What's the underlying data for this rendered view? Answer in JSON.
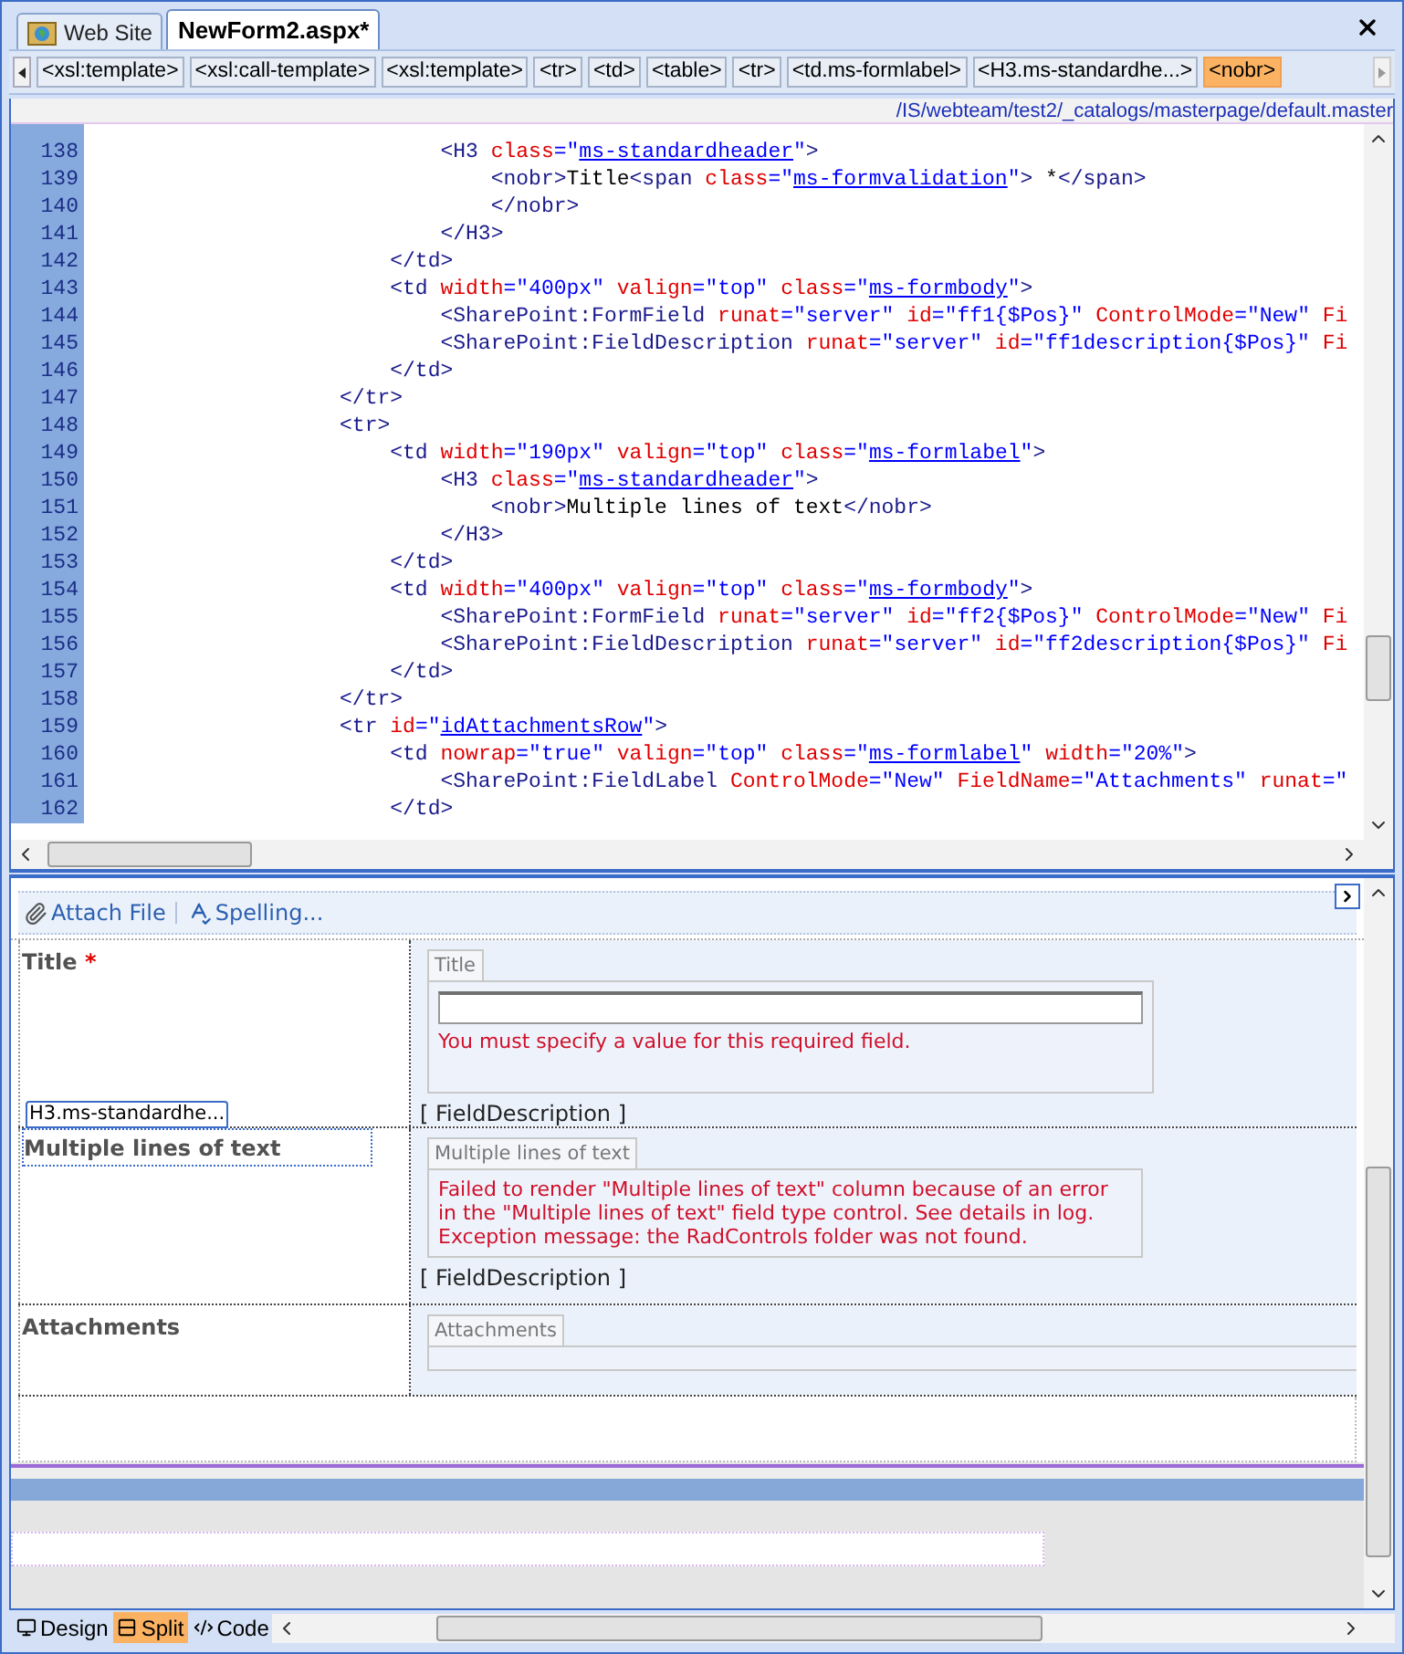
{
  "tabs": [
    {
      "label": "Web Site",
      "kind": "site",
      "selected": false
    },
    {
      "label": "NewForm2.aspx*",
      "kind": "file",
      "selected": true
    }
  ],
  "tag_path": [
    {
      "label": "<xsl:template>",
      "selected": false
    },
    {
      "label": "<xsl:call-template>",
      "selected": false
    },
    {
      "label": "<xsl:template>",
      "selected": false
    },
    {
      "label": "<tr>",
      "selected": false
    },
    {
      "label": "<td>",
      "selected": false
    },
    {
      "label": "<table>",
      "selected": false
    },
    {
      "label": "<tr>",
      "selected": false
    },
    {
      "label": "<td.ms-formlabel>",
      "selected": false
    },
    {
      "label": "<H3.ms-standardhe...>",
      "selected": false
    },
    {
      "label": "<nobr>",
      "selected": true
    }
  ],
  "file_path": "/IS/webteam/test2/_catalogs/masterpage/default.master",
  "code_lines": [
    {
      "number": "138",
      "tokens": [
        {
          "kind": "tag",
          "text": "                            <H3"
        },
        {
          "kind": "attr",
          "text": " class"
        },
        {
          "kind": "value",
          "text": "=\""
        },
        {
          "kind": "link",
          "text": "ms-standardheader"
        },
        {
          "kind": "value",
          "text": "\""
        },
        {
          "kind": "tag",
          "text": ">"
        }
      ]
    },
    {
      "number": "139",
      "tokens": [
        {
          "kind": "tag",
          "text": "                                <nobr>"
        },
        {
          "kind": "text",
          "text": "Title"
        },
        {
          "kind": "tag",
          "text": "<span"
        },
        {
          "kind": "attr",
          "text": " class"
        },
        {
          "kind": "value",
          "text": "=\""
        },
        {
          "kind": "link",
          "text": "ms-formvalidation"
        },
        {
          "kind": "value",
          "text": "\""
        },
        {
          "kind": "tag",
          "text": ">"
        },
        {
          "kind": "text",
          "text": " *"
        },
        {
          "kind": "tag",
          "text": "</span>"
        }
      ]
    },
    {
      "number": "140",
      "tokens": [
        {
          "kind": "tag",
          "text": "                                </nobr>"
        }
      ]
    },
    {
      "number": "141",
      "tokens": [
        {
          "kind": "tag",
          "text": "                            </H3>"
        }
      ]
    },
    {
      "number": "142",
      "tokens": [
        {
          "kind": "tag",
          "text": "                        </td>"
        }
      ]
    },
    {
      "number": "143",
      "tokens": [
        {
          "kind": "tag",
          "text": "                        <td"
        },
        {
          "kind": "attr",
          "text": " width"
        },
        {
          "kind": "value",
          "text": "=\"400px\""
        },
        {
          "kind": "attr",
          "text": " valign"
        },
        {
          "kind": "value",
          "text": "=\"top\""
        },
        {
          "kind": "attr",
          "text": " class"
        },
        {
          "kind": "value",
          "text": "=\""
        },
        {
          "kind": "link",
          "text": "ms-formbody"
        },
        {
          "kind": "value",
          "text": "\""
        },
        {
          "kind": "tag",
          "text": ">"
        }
      ]
    },
    {
      "number": "144",
      "tokens": [
        {
          "kind": "tag",
          "text": "                            <SharePoint:FormField"
        },
        {
          "kind": "attr",
          "text": " runat"
        },
        {
          "kind": "value",
          "text": "=\"server\""
        },
        {
          "kind": "attr",
          "text": " id"
        },
        {
          "kind": "value",
          "text": "=\"ff1{$Pos}\""
        },
        {
          "kind": "attr",
          "text": " ControlMode"
        },
        {
          "kind": "value",
          "text": "=\"New\""
        },
        {
          "kind": "attr",
          "text": " Fi"
        }
      ]
    },
    {
      "number": "145",
      "tokens": [
        {
          "kind": "tag",
          "text": "                            <SharePoint:FieldDescription"
        },
        {
          "kind": "attr",
          "text": " runat"
        },
        {
          "kind": "value",
          "text": "=\"server\""
        },
        {
          "kind": "attr",
          "text": " id"
        },
        {
          "kind": "value",
          "text": "=\"ff1description{$Pos}\""
        },
        {
          "kind": "attr",
          "text": " Fi"
        }
      ]
    },
    {
      "number": "146",
      "tokens": [
        {
          "kind": "tag",
          "text": "                        </td>"
        }
      ]
    },
    {
      "number": "147",
      "tokens": [
        {
          "kind": "tag",
          "text": "                    </tr>"
        }
      ]
    },
    {
      "number": "148",
      "tokens": [
        {
          "kind": "tag",
          "text": "                    <tr>"
        }
      ]
    },
    {
      "number": "149",
      "tokens": [
        {
          "kind": "tag",
          "text": "                        <td"
        },
        {
          "kind": "attr",
          "text": " width"
        },
        {
          "kind": "value",
          "text": "=\"190px\""
        },
        {
          "kind": "attr",
          "text": " valign"
        },
        {
          "kind": "value",
          "text": "=\"top\""
        },
        {
          "kind": "attr",
          "text": " class"
        },
        {
          "kind": "value",
          "text": "=\""
        },
        {
          "kind": "link",
          "text": "ms-formlabel"
        },
        {
          "kind": "value",
          "text": "\""
        },
        {
          "kind": "tag",
          "text": ">"
        }
      ]
    },
    {
      "number": "150",
      "tokens": [
        {
          "kind": "tag",
          "text": "                            <H3"
        },
        {
          "kind": "attr",
          "text": " class"
        },
        {
          "kind": "value",
          "text": "=\""
        },
        {
          "kind": "link",
          "text": "ms-standardheader"
        },
        {
          "kind": "value",
          "text": "\""
        },
        {
          "kind": "tag",
          "text": ">"
        }
      ]
    },
    {
      "number": "151",
      "tokens": [
        {
          "kind": "tag",
          "text": "                                <nobr>"
        },
        {
          "kind": "text",
          "text": "Multiple lines of text"
        },
        {
          "kind": "tag",
          "text": "</nobr>"
        }
      ]
    },
    {
      "number": "152",
      "tokens": [
        {
          "kind": "tag",
          "text": "                            </H3>"
        }
      ]
    },
    {
      "number": "153",
      "tokens": [
        {
          "kind": "tag",
          "text": "                        </td>"
        }
      ]
    },
    {
      "number": "154",
      "tokens": [
        {
          "kind": "tag",
          "text": "                        <td"
        },
        {
          "kind": "attr",
          "text": " width"
        },
        {
          "kind": "value",
          "text": "=\"400px\""
        },
        {
          "kind": "attr",
          "text": " valign"
        },
        {
          "kind": "value",
          "text": "=\"top\""
        },
        {
          "kind": "attr",
          "text": " class"
        },
        {
          "kind": "value",
          "text": "=\""
        },
        {
          "kind": "link",
          "text": "ms-formbody"
        },
        {
          "kind": "value",
          "text": "\""
        },
        {
          "kind": "tag",
          "text": ">"
        }
      ]
    },
    {
      "number": "155",
      "tokens": [
        {
          "kind": "tag",
          "text": "                            <SharePoint:FormField"
        },
        {
          "kind": "attr",
          "text": " runat"
        },
        {
          "kind": "value",
          "text": "=\"server\""
        },
        {
          "kind": "attr",
          "text": " id"
        },
        {
          "kind": "value",
          "text": "=\"ff2{$Pos}\""
        },
        {
          "kind": "attr",
          "text": " ControlMode"
        },
        {
          "kind": "value",
          "text": "=\"New\""
        },
        {
          "kind": "attr",
          "text": " Fi"
        }
      ]
    },
    {
      "number": "156",
      "tokens": [
        {
          "kind": "tag",
          "text": "                            <SharePoint:FieldDescription"
        },
        {
          "kind": "attr",
          "text": " runat"
        },
        {
          "kind": "value",
          "text": "=\"server\""
        },
        {
          "kind": "attr",
          "text": " id"
        },
        {
          "kind": "value",
          "text": "=\"ff2description{$Pos}\""
        },
        {
          "kind": "attr",
          "text": " Fi"
        }
      ]
    },
    {
      "number": "157",
      "tokens": [
        {
          "kind": "tag",
          "text": "                        </td>"
        }
      ]
    },
    {
      "number": "158",
      "tokens": [
        {
          "kind": "tag",
          "text": "                    </tr>"
        }
      ]
    },
    {
      "number": "159",
      "tokens": [
        {
          "kind": "tag",
          "text": "                    <tr"
        },
        {
          "kind": "attr",
          "text": " id"
        },
        {
          "kind": "value",
          "text": "=\""
        },
        {
          "kind": "link",
          "text": "idAttachmentsRow"
        },
        {
          "kind": "value",
          "text": "\""
        },
        {
          "kind": "tag",
          "text": ">"
        }
      ]
    },
    {
      "number": "160",
      "tokens": [
        {
          "kind": "tag",
          "text": "                        <td"
        },
        {
          "kind": "attr",
          "text": " nowrap"
        },
        {
          "kind": "value",
          "text": "=\"true\""
        },
        {
          "kind": "attr",
          "text": " valign"
        },
        {
          "kind": "value",
          "text": "=\"top\""
        },
        {
          "kind": "attr",
          "text": " class"
        },
        {
          "kind": "value",
          "text": "=\""
        },
        {
          "kind": "link",
          "text": "ms-formlabel"
        },
        {
          "kind": "value",
          "text": "\""
        },
        {
          "kind": "attr",
          "text": " width"
        },
        {
          "kind": "value",
          "text": "=\"20%\""
        },
        {
          "kind": "tag",
          "text": ">"
        }
      ]
    },
    {
      "number": "161",
      "tokens": [
        {
          "kind": "tag",
          "text": "                            <SharePoint:FieldLabel"
        },
        {
          "kind": "attr",
          "text": " ControlMode"
        },
        {
          "kind": "value",
          "text": "=\"New\""
        },
        {
          "kind": "attr",
          "text": " FieldName"
        },
        {
          "kind": "value",
          "text": "=\"Attachments\""
        },
        {
          "kind": "attr",
          "text": " runat"
        },
        {
          "kind": "value",
          "text": "=\""
        }
      ]
    },
    {
      "number": "162",
      "tokens": [
        {
          "kind": "tag",
          "text": "                        </td>"
        }
      ]
    }
  ],
  "design": {
    "toolbar": [
      {
        "label": "Attach File",
        "kind": "attach"
      },
      {
        "label": "Spelling...",
        "kind": "spelling"
      }
    ],
    "tag_hint": "H3.ms-standardhe...",
    "rows": [
      {
        "label": "Title",
        "required_mark": "*",
        "selected": false,
        "field_tab": "Title",
        "kind": "input",
        "message": "You must specify a value for this required field.",
        "description": "[ FieldDescription ]"
      },
      {
        "label": "Multiple lines of text",
        "selected": true,
        "field_tab": "Multiple lines of text",
        "kind": "error",
        "message": "Failed to render \"Multiple lines of text\" column because of an error in the \"Multiple lines of text\" field type control. See details in log. Exception message: the RadControls folder was not found.",
        "description": "[ FieldDescription ]"
      },
      {
        "label": "Attachments",
        "selected": false,
        "field_tab": "Attachments",
        "kind": "empty"
      }
    ]
  },
  "view_tabs": [
    {
      "label": "Design",
      "kind": "design",
      "selected": false
    },
    {
      "label": "Split",
      "kind": "split",
      "selected": true
    },
    {
      "label": "Code",
      "kind": "code",
      "selected": false
    }
  ]
}
